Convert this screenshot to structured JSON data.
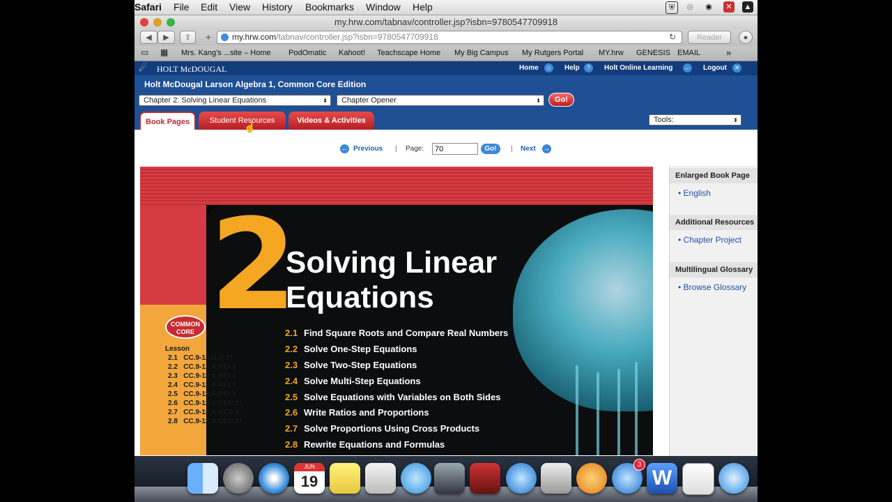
{
  "menubar": {
    "app": "Safari",
    "items": [
      "File",
      "Edit",
      "View",
      "History",
      "Bookmarks",
      "Window",
      "Help"
    ]
  },
  "window": {
    "title": "my.hrw.com/tabnav/controller.jsp?isbn=9780547709918"
  },
  "toolbar": {
    "url_domain": "my.hrw.com",
    "url_path": "/tabnav/controller.jsp?isbn=9780547709918",
    "reader_label": "Reader"
  },
  "bookmarks": [
    "Mrs. Kang's ...site – Home",
    "PodOmatic",
    "Kahoot!",
    "Teachscape Home",
    "My Big Campus",
    "My Rutgers Portal",
    "MY.hrw",
    "GENESIS",
    "EMAIL"
  ],
  "hrw": {
    "brand": "HOLT McDOUGAL",
    "nav": {
      "home": "Home",
      "help": "Help",
      "holt_online": "Holt Online Learning",
      "logout": "Logout"
    },
    "book_title": "Holt McDougal Larson Algebra 1, Common Core Edition",
    "chapter_select": "Chapter 2: Solving Linear Equations",
    "section_select": "Chapter Opener",
    "go_label": "Go!",
    "tools_select": "Tools:",
    "tabs": {
      "book_pages": "Book Pages",
      "student_resources": "Student Resources",
      "videos": "Videos & Activities"
    },
    "pager": {
      "previous": "Previous",
      "sep": "|",
      "page_label": "Page:",
      "page_value": "70",
      "go": "Go!",
      "next": "Next"
    }
  },
  "book": {
    "chapter_number": "2",
    "chapter_title": "Solving Linear\nEquations",
    "common_core": "COMMON\nCORE",
    "lesson_label": "Lesson",
    "standards": [
      {
        "lesson": "2.1",
        "code": "CC.9-12.N.Q.1*"
      },
      {
        "lesson": "2.2",
        "code": "CC.9-12.A.REI.3"
      },
      {
        "lesson": "2.3",
        "code": "CC.9-12.A.REI.3"
      },
      {
        "lesson": "2.4",
        "code": "CC.9-12.A.REI.3"
      },
      {
        "lesson": "2.5",
        "code": "CC.9-12.A.REI.3"
      },
      {
        "lesson": "2.6",
        "code": "CC.9-12.A.CED.1*"
      },
      {
        "lesson": "2.7",
        "code": "CC.9-12.A.CED.1*"
      },
      {
        "lesson": "2.8",
        "code": "CC.9-12.A.CED.4*"
      }
    ],
    "lessons": [
      {
        "num": "2.1",
        "title": "Find Square Roots and Compare Real Numbers"
      },
      {
        "num": "2.2",
        "title": "Solve One-Step Equations"
      },
      {
        "num": "2.3",
        "title": "Solve Two-Step Equations"
      },
      {
        "num": "2.4",
        "title": "Solve Multi-Step Equations"
      },
      {
        "num": "2.5",
        "title": "Solve Equations with Variables on Both Sides"
      },
      {
        "num": "2.6",
        "title": "Write Ratios and Proportions"
      },
      {
        "num": "2.7",
        "title": "Solve Proportions Using Cross Products"
      },
      {
        "num": "2.8",
        "title": "Rewrite Equations and Formulas"
      }
    ]
  },
  "sidebar": {
    "enlarged_header": "Enlarged Book Page",
    "english": "English",
    "additional_header": "Additional Resources",
    "chapter_project": "Chapter Project",
    "glossary_header": "Multilingual Glossary",
    "browse_glossary": "Browse Glossary"
  },
  "dock": {
    "calendar_month": "JUN",
    "calendar_day": "19",
    "appstore_badge": "3"
  }
}
